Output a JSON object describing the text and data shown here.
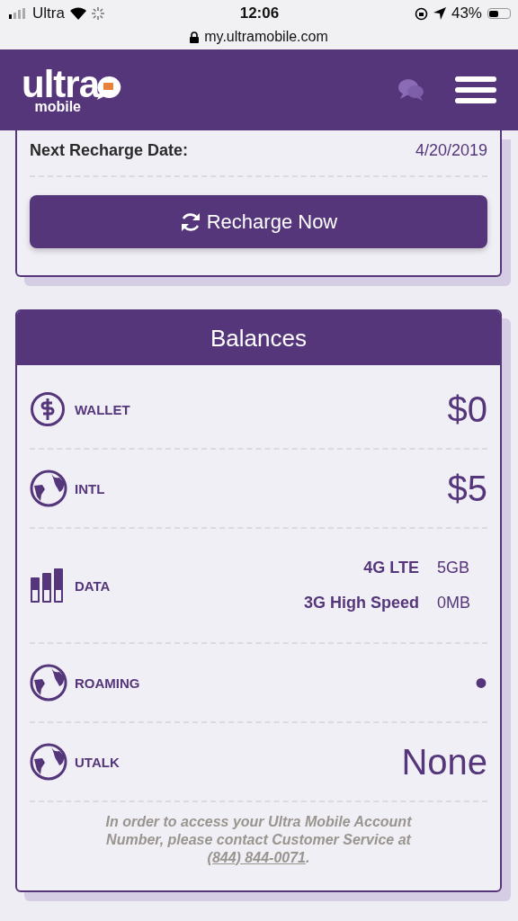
{
  "status_bar": {
    "carrier": "Ultra",
    "time": "12:06",
    "battery": "43%",
    "url": "my.ultramobile.com"
  },
  "header": {
    "logo": "ultra",
    "logo_sub": "mobile"
  },
  "recharge": {
    "label": "Next Recharge Date:",
    "value": "4/20/2019",
    "button": "Recharge Now"
  },
  "balances": {
    "title": "Balances",
    "rows": [
      {
        "kind": "wallet",
        "label": "WALLET",
        "value": "$0"
      },
      {
        "kind": "globe",
        "label": "INTL",
        "value": "$5"
      },
      {
        "kind": "data",
        "label": "DATA",
        "plans": [
          {
            "name": "4G LTE",
            "amount": "5GB"
          },
          {
            "name": "3G High Speed",
            "amount": "0MB"
          }
        ]
      },
      {
        "kind": "globe",
        "label": "ROAMING",
        "value": "•"
      },
      {
        "kind": "globe",
        "label": "UTALK",
        "value": "None"
      }
    ],
    "note": "In order to access your Ultra Mobile Account Number, please contact Customer Service at",
    "phone": "(844) 844-0071",
    "note_end": "."
  }
}
